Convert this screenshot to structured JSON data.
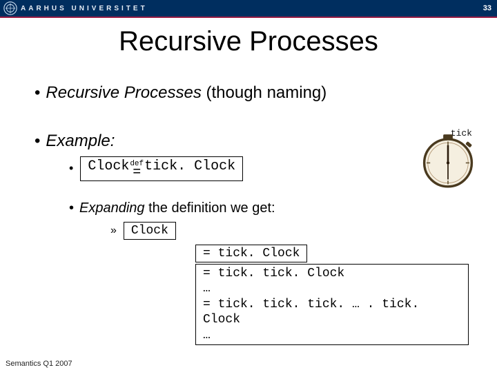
{
  "header": {
    "university": "AARHUS UNIVERSITET",
    "slide_number": "33"
  },
  "title": "Recursive Processes",
  "bullets": {
    "b1_prefix": "Recursive Processes",
    "b1_suffix": " (though naming)",
    "b2": "Example:",
    "clock_def": {
      "lhs": "Clock ",
      "def_label": "def",
      "eq": "=",
      "rhs": " tick. Clock"
    },
    "expand_prefix": "Expanding",
    "expand_suffix": " the definition we get:",
    "clock_word": "Clock",
    "expansion": {
      "row1": "= tick. Clock",
      "row2_l1": "= tick. tick. Clock",
      "row2_l2": "…",
      "row2_l3": "= tick. tick. tick. … . tick. Clock",
      "row2_l4": "…"
    }
  },
  "clock_image": {
    "label": "tick"
  },
  "footer": "Semantics Q1 2007"
}
